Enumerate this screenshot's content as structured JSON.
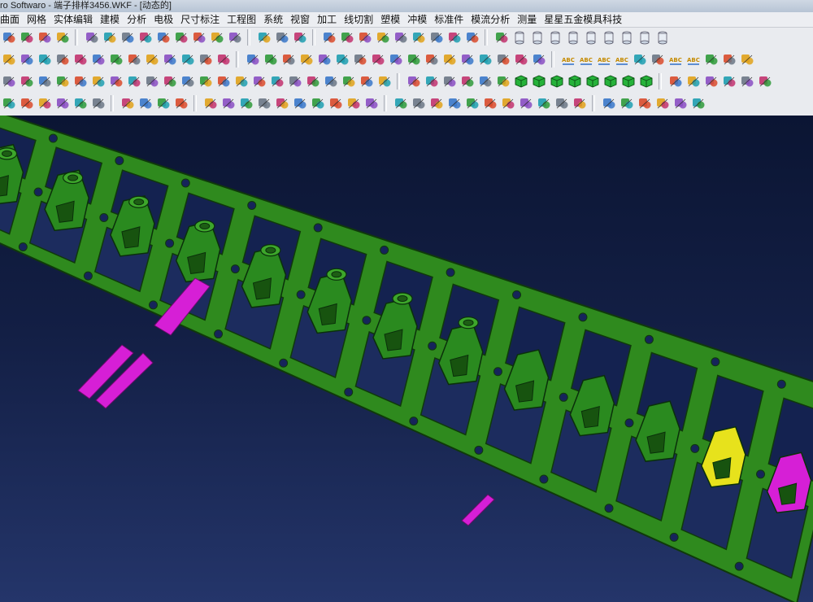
{
  "window": {
    "title": "ro Softwaro - 端子排样3456.WKF - [动态的]"
  },
  "menu": {
    "items": [
      "曲面",
      "网格",
      "实体编辑",
      "建模",
      "分析",
      "电极",
      "尺寸标注",
      "工程图",
      "系统",
      "视窗",
      "加工",
      "线切割",
      "塑模",
      "冲模",
      "标准件",
      "模流分析",
      "测量",
      "星星五金模具科技"
    ]
  },
  "toolbar_rows": [
    {
      "groups": [
        [
          "open-icon",
          "print-icon",
          "zoom-icon",
          "window-icon"
        ],
        [
          "solid-edit-icon",
          "shell-icon",
          "gear-icon",
          "gear-icon",
          "rotate-icon",
          "gear-icon",
          "gear-icon",
          "gear-icon",
          "gear-icon"
        ],
        [
          "analysis-icon",
          "analysis-icon",
          "analysis-icon"
        ],
        [
          "trash-icon",
          "curve-icon",
          "line-icon",
          "arc-icon",
          "dimension-icon",
          "dimension-icon",
          "dimension-icon",
          "dimension-icon",
          "gear-icon"
        ],
        [
          "refresh-icon",
          "cylinder-icon",
          "cylinder-icon",
          "cylinder-icon",
          "cylinder-icon",
          "cylinder-icon",
          "cylinder-icon",
          "cylinder-icon",
          "cylinder-icon",
          "cylinder-icon"
        ]
      ]
    },
    {
      "groups": [
        [
          "pen-icon",
          "surface-icon",
          "surface-icon",
          "surface-icon",
          "curve-icon",
          "surface-icon",
          "surface-icon",
          "surface-icon",
          "surface-icon",
          "surface-icon",
          "surface-icon",
          "surface-icon",
          "surface-icon"
        ],
        [
          "solid-icon",
          "solid-icon",
          "solid-icon",
          "solid-icon",
          "solid-icon",
          "solid-icon",
          "solid-icon",
          "solid-icon",
          "solid-icon",
          "solid-icon",
          "solid-icon",
          "solid-icon",
          "solid-icon",
          "solid-icon",
          "solid-icon",
          "solid-icon",
          "solid-icon"
        ],
        [
          "abc-icon",
          "abc-icon",
          "abc-icon",
          "abc-icon",
          "angle-icon",
          "search-icon",
          "abc-icon",
          "abc-icon",
          "target-icon",
          "ruler-icon",
          "ruler-icon"
        ]
      ]
    },
    {
      "groups": [
        [
          "shape-icon",
          "shape-icon",
          "shape-icon",
          "shape-icon",
          "shape-icon",
          "shape-icon",
          "shape-icon",
          "shape-icon",
          "shape-icon",
          "shape-icon",
          "shape-icon",
          "shape-icon",
          "shape-icon",
          "shape-icon",
          "shape-icon",
          "shape-icon",
          "shape-icon",
          "shape-icon",
          "shape-icon",
          "shape-icon",
          "shape-icon",
          "shape-icon"
        ],
        [
          "transform-icon",
          "transform-icon",
          "transform-icon",
          "transform-icon",
          "transform-icon",
          "transform-icon",
          "cube-icon",
          "cube-icon",
          "cube-icon",
          "cube-icon",
          "cube-icon",
          "cube-icon",
          "cube-icon",
          "cube-icon"
        ],
        [
          "measure-icon",
          "measure-icon",
          "measure-icon",
          "measure-icon",
          "measure-icon",
          "measure-icon"
        ]
      ]
    },
    {
      "groups": [
        [
          "circle-icon",
          "arc-icon",
          "polygon-icon",
          "page-icon",
          "page-icon",
          "page-icon"
        ],
        [
          "box-icon",
          "box-icon",
          "box-icon",
          "box-icon"
        ],
        [
          "mold-icon",
          "mold-icon",
          "mold-icon",
          "mold-icon",
          "mold-icon",
          "mold-icon",
          "mold-icon",
          "mold-icon",
          "mold-icon",
          "mold-icon"
        ],
        [
          "plate-icon",
          "plate-icon",
          "plate-icon",
          "plate-icon",
          "plate-icon",
          "plate-icon",
          "plate-icon",
          "plate-icon",
          "plate-icon",
          "plate-icon",
          "plate-icon"
        ],
        [
          "help-icon",
          "query-icon",
          "query-icon",
          "query-icon",
          "query-icon",
          "query-icon"
        ]
      ]
    }
  ],
  "toolbar_colors": [
    "#3a78c9",
    "#2f9a3a",
    "#d94b2b",
    "#e0a21a",
    "#8a4fc2",
    "#1f9fb0",
    "#6b7785",
    "#c2336e"
  ],
  "viewport": {
    "colors": {
      "background_top": "#0b1533",
      "background_bottom": "#24356a",
      "strip": "#2f8a1e",
      "strip_edge": "#0f3a0a",
      "highlight_magenta": "#d61fd6",
      "highlight_yellow": "#e7e21c"
    }
  }
}
